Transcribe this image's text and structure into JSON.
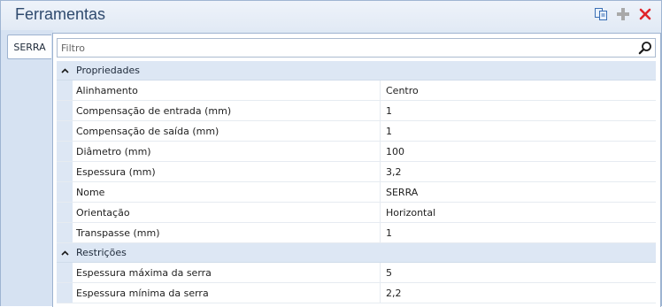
{
  "window": {
    "title": "Ferramentas"
  },
  "toolbar": {
    "copy_icon": "copy-icon",
    "add_icon": "plus-icon",
    "close_icon": "close-icon",
    "close_color": "#e0252b"
  },
  "tabs": [
    {
      "label": "SERRA",
      "selected": true
    }
  ],
  "filter": {
    "placeholder": "Filtro",
    "value": ""
  },
  "grid": {
    "categories": [
      {
        "label": "Propriedades",
        "expanded": true,
        "rows": [
          {
            "name": "Alinhamento",
            "value": "Centro"
          },
          {
            "name": "Compensação de entrada (mm)",
            "value": "1"
          },
          {
            "name": "Compensação de saída (mm)",
            "value": "1"
          },
          {
            "name": "Diâmetro (mm)",
            "value": "100"
          },
          {
            "name": "Espessura (mm)",
            "value": "3,2"
          },
          {
            "name": "Nome",
            "value": "SERRA"
          },
          {
            "name": "Orientação",
            "value": "Horizontal"
          },
          {
            "name": "Transpasse (mm)",
            "value": "1"
          }
        ]
      },
      {
        "label": "Restrições",
        "expanded": true,
        "rows": [
          {
            "name": "Espessura máxima da serra",
            "value": "5"
          },
          {
            "name": "Espessura mínima da serra",
            "value": "2,2"
          }
        ]
      }
    ]
  }
}
